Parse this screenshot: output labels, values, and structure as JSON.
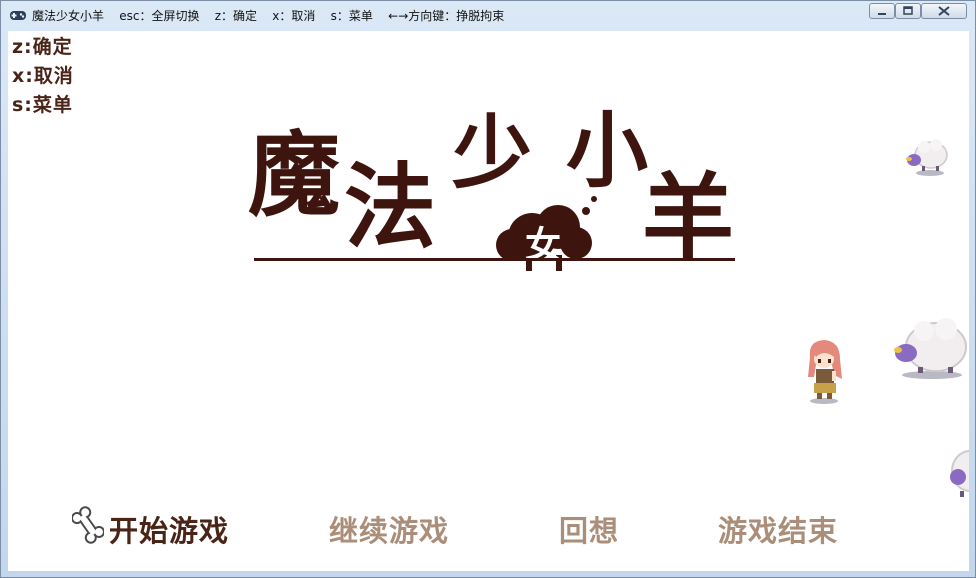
{
  "window": {
    "title": "魔法少女小羊    esc：全屏切换    z：确定    x：取消    s：菜单    ←→方向键：挣脱拘束",
    "controls": [
      "minimize-icon",
      "maximize-icon",
      "close-icon"
    ]
  },
  "hints": [
    {
      "key": "z",
      "text": "z:确定"
    },
    {
      "key": "x",
      "text": "x:取消"
    },
    {
      "key": "s",
      "text": "s:菜单"
    }
  ],
  "logo": {
    "chars": [
      "魔",
      "法",
      "少",
      "女",
      "小",
      "羊"
    ]
  },
  "menu": {
    "items": [
      {
        "label": "开始游戏",
        "state": "selected"
      },
      {
        "label": "继续游戏",
        "state": "disabled"
      },
      {
        "label": "回想",
        "state": "disabled"
      },
      {
        "label": "游戏结束",
        "state": "disabled"
      }
    ],
    "cursor_icon": "bone-icon"
  },
  "colors": {
    "logo": "#3e150e",
    "menu_active": "#4a2417",
    "menu_inactive": "#ab8e79",
    "sheep_wool": "#f2eef0",
    "sheep_face": "#8a6bc2",
    "girl_hair": "#e48a7c"
  }
}
